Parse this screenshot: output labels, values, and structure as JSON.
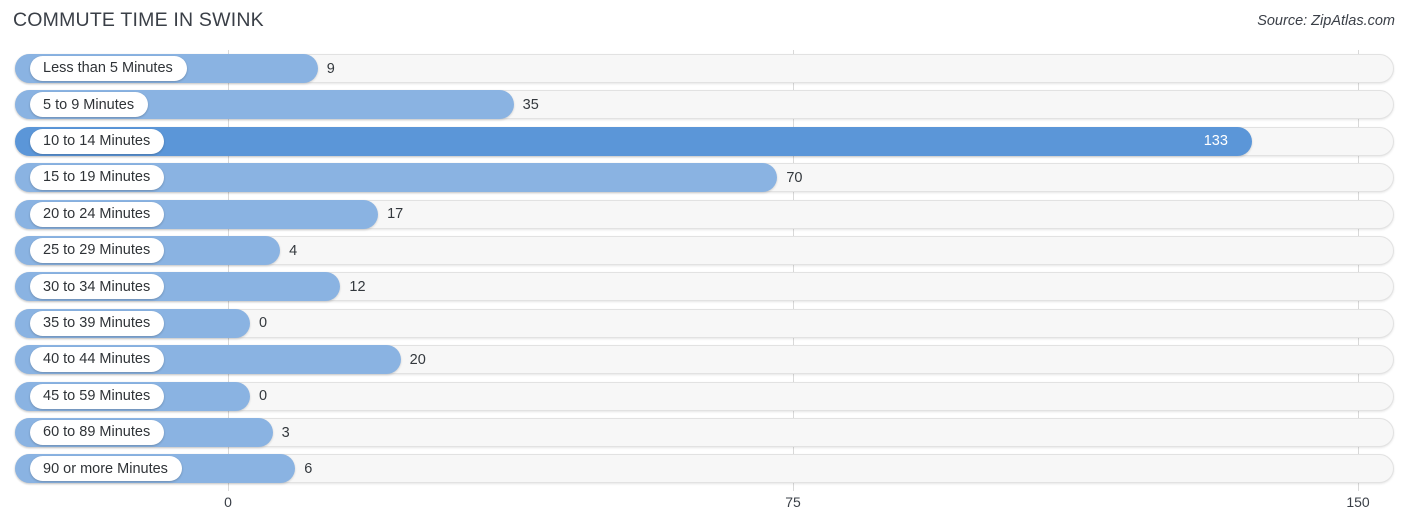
{
  "header": {
    "title": "COMMUTE TIME IN SWINK",
    "source": "Source: ZipAtlas.com"
  },
  "axis": {
    "ticks": [
      "0",
      "75",
      "150"
    ]
  },
  "colors": {
    "bar": "#8ab3e2",
    "bar_max": "#5b96d8",
    "track": "#f7f7f7",
    "grid": "#d9d9d9",
    "text": "#3a3f47"
  },
  "chart_data": {
    "type": "bar",
    "orientation": "horizontal",
    "title": "COMMUTE TIME IN SWINK",
    "subtitle": "",
    "source": "Source: ZipAtlas.com",
    "xlabel": "",
    "ylabel": "",
    "xlim": [
      0,
      150
    ],
    "xticks": [
      0,
      75,
      150
    ],
    "grid": true,
    "legend": "none",
    "categories": [
      "Less than 5 Minutes",
      "5 to 9 Minutes",
      "10 to 14 Minutes",
      "15 to 19 Minutes",
      "20 to 24 Minutes",
      "25 to 29 Minutes",
      "30 to 34 Minutes",
      "35 to 39 Minutes",
      "40 to 44 Minutes",
      "45 to 59 Minutes",
      "60 to 89 Minutes",
      "90 or more Minutes"
    ],
    "values": [
      9,
      35,
      133,
      70,
      17,
      4,
      12,
      0,
      20,
      0,
      3,
      6
    ],
    "value_labels": [
      "9",
      "35",
      "133",
      "70",
      "17",
      "4",
      "12",
      "0",
      "20",
      "0",
      "3",
      "6"
    ],
    "max_value": 133,
    "highlight_index": 2
  }
}
